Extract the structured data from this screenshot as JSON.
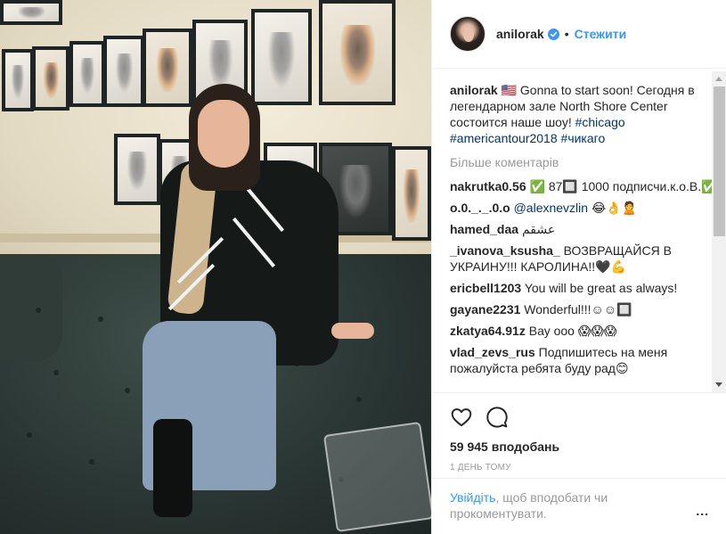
{
  "post": {
    "image_alt": "Photo of a woman sitting on a dark green leather sofa in front of a wall of framed signed portraits"
  },
  "header": {
    "username": "anilorak",
    "separator": "•",
    "follow_label": "Стежити"
  },
  "caption": {
    "username": "anilorak",
    "emoji": "🇺🇸",
    "text_1": " Gonna to start soon! Сегодня в легендарном зале North Shore Center состоится наше шоу! ",
    "tag_1": "#chicago",
    "tag_2": "#americantour2018",
    "tag_3": "#чикаго"
  },
  "more_comments_label": "Більше коментарів",
  "comments": [
    {
      "user": "nakrutka0.56",
      "text": "✅ 87🔲 1000 подписчи.к.о.В.✅"
    },
    {
      "user": "o.0._._.0.o",
      "mention": "@alexnevzlin",
      "text": "😂👌🙎"
    },
    {
      "user": "hamed_daa",
      "text": "عشقم"
    },
    {
      "user": "_ivanova_ksusha_",
      "text": "ВОЗВРАЩАЙСЯ В УКРАИНУ!!! КАРОЛИНА!!🖤💪"
    },
    {
      "user": "ericbell1203",
      "text": "You will be great as always!"
    },
    {
      "user": "gayane2231",
      "text": "Wonderful!!!☺☺🔲"
    },
    {
      "user": "zkatya64.91z",
      "text": "Вау ооо 😱😱😱"
    },
    {
      "user": "vlad_zevs_rus",
      "text": "Подпишитесь на меня пожалуйста ребята буду рад😊"
    }
  ],
  "actions": {
    "likes": "59 945 вподобань",
    "date": "1 день тому"
  },
  "login": {
    "link": "Увійдіть",
    "text": ", щоб вподобати чи прокоментувати.",
    "options": "..."
  },
  "colors": {
    "link": "#3897f0",
    "hashtag": "#003569",
    "muted": "#999999",
    "verified": "#3897f0"
  }
}
